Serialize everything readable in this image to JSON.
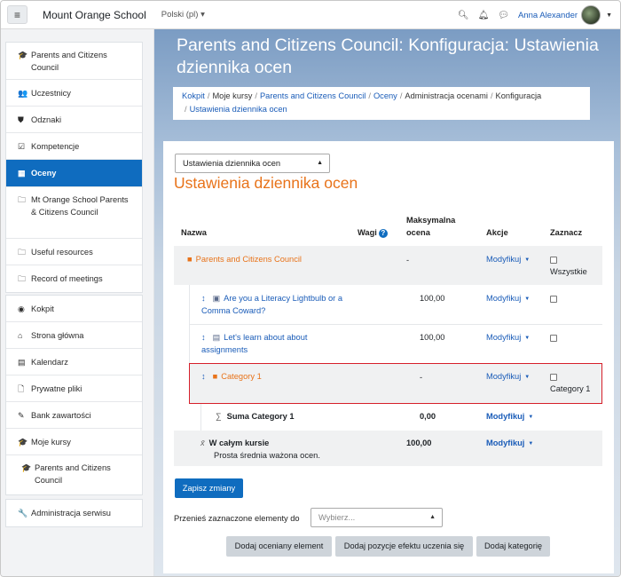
{
  "navbar": {
    "site_name": "Mount Orange School",
    "language": "Polski (pl)",
    "language_caret": "▾",
    "user_name": "Anna Alexander",
    "icons": [
      "search-icon",
      "bell-icon",
      "chat-icon"
    ]
  },
  "sidebar": {
    "block1": [
      {
        "label": "Parents and Citizens Council",
        "icon": "graduation-cap-icon",
        "glyph": "🎓"
      },
      {
        "label": "Uczestnicy",
        "icon": "users-icon",
        "glyph": "👥"
      },
      {
        "label": "Odznaki",
        "icon": "shield-icon",
        "glyph": "⛊"
      },
      {
        "label": "Kompetencje",
        "icon": "checkbox-icon",
        "glyph": "☑"
      },
      {
        "label": "Oceny",
        "icon": "table-icon",
        "glyph": "▦",
        "active": true
      },
      {
        "label": "Mt Orange School Parents & Citizens Council",
        "icon": "folder-outline-icon",
        "glyph": "🗀"
      },
      {
        "label": "Useful resources",
        "icon": "folder-outline-icon",
        "glyph": "🗀"
      },
      {
        "label": "Record of meetings",
        "icon": "folder-outline-icon",
        "glyph": "🗀"
      }
    ],
    "block2": [
      {
        "label": "Kokpit",
        "icon": "dashboard-icon",
        "glyph": "◉"
      },
      {
        "label": "Strona główna",
        "icon": "home-icon",
        "glyph": "⌂"
      },
      {
        "label": "Kalendarz",
        "icon": "calendar-icon",
        "glyph": "▤"
      },
      {
        "label": "Prywatne pliki",
        "icon": "file-icon",
        "glyph": "🗋"
      },
      {
        "label": "Bank zawartości",
        "icon": "brush-icon",
        "glyph": "✎"
      },
      {
        "label": "Moje kursy",
        "icon": "graduation-cap-icon",
        "glyph": "🎓"
      },
      {
        "label": "Parents and Citizens Council",
        "icon": "graduation-cap-icon",
        "glyph": "🎓"
      }
    ],
    "block3": [
      {
        "label": "Administracja serwisu",
        "icon": "wrench-icon",
        "glyph": "🔧"
      }
    ]
  },
  "page": {
    "title": "Parents and Citizens Council: Konfiguracja: Ustawienia dziennika ocen",
    "breadcrumb": [
      "Kokpit",
      "Moje kursy",
      "Parents and Citizens Council",
      "Oceny",
      "Administracja ocenami",
      "Konfiguracja",
      "Ustawienia dziennika ocen"
    ]
  },
  "main": {
    "selector_value": "Ustawienia dziennika ocen",
    "heading": "Ustawienia dziennika ocen",
    "table": {
      "headers": {
        "name": "Nazwa",
        "weights": "Wagi",
        "max_grade": "Maksymalna ocena",
        "actions": "Akcje",
        "select": "Zaznacz"
      },
      "rows": {
        "category_main": {
          "name": "Parents and Citizens Council",
          "max": "-",
          "action": "Modyfikuj",
          "select_label": "Wszystkie"
        },
        "item1": {
          "name": "Are you a Literacy Lightbulb or a Comma Coward?",
          "max": "100,00",
          "action": "Modyfikuj"
        },
        "item2": {
          "name": "Let's learn about about assignments",
          "max": "100,00",
          "action": "Modyfikuj"
        },
        "category1": {
          "name": "Category 1",
          "max": "-",
          "action": "Modyfikuj",
          "select_label": "Category 1"
        },
        "sum_category": {
          "name": "Suma Category 1",
          "max": "0,00",
          "action": "Modyfikuj"
        },
        "course_total": {
          "name": "W całym kursie",
          "subtitle": "Prosta średnia ważona ocen.",
          "max": "100,00",
          "action": "Modyfikuj"
        }
      }
    },
    "save_button": "Zapisz zmiany",
    "move_label": "Przenieś zaznaczone elementy do",
    "move_placeholder": "Wybierz...",
    "buttons": {
      "add_item": "Dodaj oceniany element",
      "add_outcome": "Dodaj pozycje efektu uczenia się",
      "add_category": "Dodaj kategorię"
    }
  },
  "colors": {
    "accent": "#0f6cbf",
    "orange": "#e8731a",
    "highlight_border": "#d61f2a"
  }
}
